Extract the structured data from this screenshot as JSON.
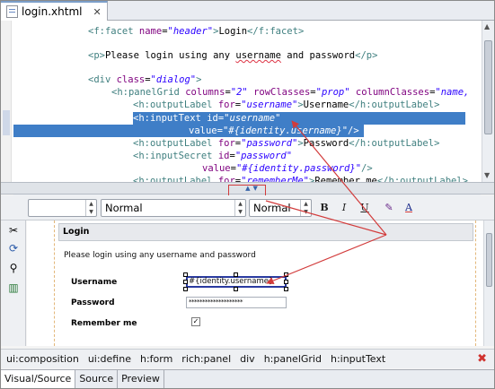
{
  "editor_tab": {
    "title": "login.xhtml",
    "close_symbol": "✕"
  },
  "source": {
    "lines": [
      {
        "parts": [
          [
            "tag",
            "<f:facet "
          ],
          [
            "attr",
            "name"
          ],
          [
            "txt",
            "="
          ],
          [
            "val",
            "\"header\""
          ],
          [
            "tag",
            ">"
          ],
          [
            "txt",
            "Login"
          ],
          [
            "tag",
            "</f:facet>"
          ]
        ]
      },
      {
        "parts": [
          [
            "tag",
            "<p>"
          ],
          [
            "txt",
            "Please login using any "
          ],
          [
            "sq",
            "username"
          ],
          [
            "txt",
            " and password"
          ],
          [
            "tag",
            "</p>"
          ]
        ]
      },
      {
        "parts": [
          [
            "tag",
            "<div "
          ],
          [
            "attr",
            "class"
          ],
          [
            "txt",
            "="
          ],
          [
            "val",
            "\"dialog\""
          ],
          [
            "tag",
            ">"
          ]
        ]
      },
      {
        "parts": [
          [
            "tag",
            "<h:panelGrid "
          ],
          [
            "attr",
            "columns"
          ],
          [
            "txt",
            "="
          ],
          [
            "val",
            "\"2\" "
          ],
          [
            "attr",
            "rowClasses"
          ],
          [
            "txt",
            "="
          ],
          [
            "val",
            "\"prop\" "
          ],
          [
            "attr",
            "columnClasses"
          ],
          [
            "txt",
            "="
          ],
          [
            "val",
            "\"name,"
          ]
        ]
      },
      {
        "parts": [
          [
            "tag",
            "<h:outputLabel "
          ],
          [
            "attr",
            "for"
          ],
          [
            "txt",
            "="
          ],
          [
            "val",
            "\"username\""
          ],
          [
            "tag",
            ">"
          ],
          [
            "txt",
            "Username"
          ],
          [
            "tag",
            "</h:outputLabel>"
          ]
        ]
      },
      {
        "parts": [
          [
            "tag",
            "<h:inputText "
          ],
          [
            "attr",
            "id"
          ],
          [
            "txt",
            "="
          ],
          [
            "val",
            "\"username\""
          ]
        ]
      },
      {
        "parts": [
          [
            "attr",
            "value"
          ],
          [
            "txt",
            "="
          ],
          [
            "val",
            "\"#{identity.username}\""
          ],
          [
            "tag",
            "/>"
          ]
        ]
      },
      {
        "parts": [
          [
            "tag",
            "<h:outputLabel "
          ],
          [
            "attr",
            "for"
          ],
          [
            "txt",
            "="
          ],
          [
            "val",
            "\"password\""
          ],
          [
            "tag",
            ">"
          ],
          [
            "txt",
            "Password"
          ],
          [
            "tag",
            "</h:outputLabel>"
          ]
        ]
      },
      {
        "parts": [
          [
            "tag",
            "<h:inputSecret "
          ],
          [
            "attr",
            "id"
          ],
          [
            "txt",
            "="
          ],
          [
            "val",
            "\"password\""
          ]
        ]
      },
      {
        "parts": [
          [
            "attr",
            "value"
          ],
          [
            "txt",
            "="
          ],
          [
            "val",
            "\"#{identity.password}\""
          ],
          [
            "tag",
            "/>"
          ]
        ]
      },
      {
        "parts": [
          [
            "tag",
            "<h:outputLabel "
          ],
          [
            "attr",
            "for"
          ],
          [
            "txt",
            "="
          ],
          [
            "val",
            "\"rememberMe\""
          ],
          [
            "tag",
            ">"
          ],
          [
            "txt",
            "Remember me"
          ],
          [
            "tag",
            "</h:outputLabel>"
          ]
        ]
      }
    ]
  },
  "toolbar": {
    "style_value": "",
    "format_value": "Normal",
    "size_value": "Normal",
    "bold_label": "B",
    "italic_label": "I",
    "underline_label": "U",
    "color_label": "A"
  },
  "visual": {
    "panel_title": "Login",
    "intro_text": "Please login using any username and password",
    "username_label": "Username",
    "username_value": "#{identity.username}",
    "password_label": "Password",
    "password_value": "********************",
    "remember_label": "Remember me",
    "remember_checked": "✓"
  },
  "breadcrumb": [
    "ui:composition",
    "ui:define",
    "h:form",
    "rich:panel",
    "div",
    "h:panelGrid",
    "h:inputText"
  ],
  "breadcrumb_close": "✖",
  "bottom_tabs": [
    "Visual/Source",
    "Source",
    "Preview"
  ],
  "colors": {
    "selection": "#3f7ec7",
    "annotation": "#d23b3b",
    "tag": "#3f7f7f",
    "attribute": "#7f007f",
    "value": "#2a00ff"
  }
}
